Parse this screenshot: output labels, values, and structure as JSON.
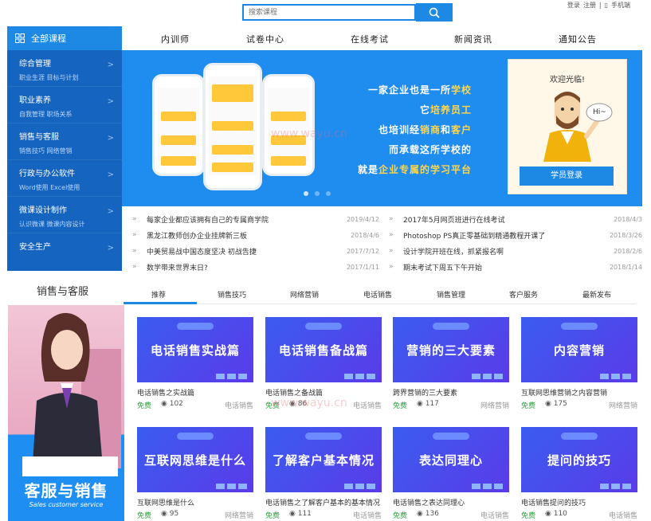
{
  "search": {
    "placeholder": "搜索课程"
  },
  "top_links": {
    "login": "登录",
    "register": "注册",
    "mobile": "手机端"
  },
  "sidebar": {
    "title": "全部课程",
    "items": [
      {
        "label": "综合管理",
        "sub": "职业生涯  目标与计划"
      },
      {
        "label": "职业素养",
        "sub": "自我管理  职场关系"
      },
      {
        "label": "销售与客服",
        "sub": "销售技巧  网络营销"
      },
      {
        "label": "行政与办公软件",
        "sub": "Word使用  Excel使用"
      },
      {
        "label": "微课设计制作",
        "sub": "认识微课  微课内容设计"
      },
      {
        "label": "安全生产",
        "sub": ""
      }
    ]
  },
  "nav": [
    "内训师",
    "试卷中心",
    "在线考试",
    "新闻资讯",
    "通知公告"
  ],
  "banner": {
    "slogans": [
      {
        "a": "一家企业也是一所",
        "b": "学校"
      },
      {
        "a": "它",
        "b": "培养员工",
        "c": ""
      },
      {
        "a": "也培训经",
        "b": "销商",
        "c": "和",
        "d": "客户"
      },
      {
        "a": "而承载这所学校的",
        "b": ""
      },
      {
        "a": "就是",
        "b": "企业专属的学习平台"
      }
    ],
    "welcome": "欢迎光临!",
    "greeting": "Hi~",
    "login_button": "学员登录"
  },
  "news_left": [
    {
      "title": "每家企业都应该拥有自己的专属商学院",
      "date": "2019/4/12"
    },
    {
      "title": "黑龙江教师创办企业挂牌新三板",
      "date": "2018/4/6"
    },
    {
      "title": "中美贸易战中国态度坚决 初战告捷",
      "date": "2017/7/12"
    },
    {
      "title": "数学带来世界末日?",
      "date": "2017/1/11"
    }
  ],
  "news_right": [
    {
      "title": "2017年5月网页班进行在线考试",
      "date": "2018/4/3"
    },
    {
      "title": "Photoshop PS真正零基础到精通教程开课了",
      "date": "2018/3/26"
    },
    {
      "title": "设计学院开班在线，抓紧报名啊",
      "date": "2018/2/6"
    },
    {
      "title": "期末考试下周五下午开始",
      "date": "2018/1/14"
    }
  ],
  "section": {
    "title": "销售与客服",
    "tabs": [
      "推荐",
      "销售技巧",
      "网络营销",
      "电话销售",
      "销售管理",
      "客户服务",
      "最新发布"
    ],
    "promo_title": "客服与销售",
    "promo_sub": "Sales customer service"
  },
  "courses": [
    {
      "cover": "电话销售实战篇",
      "name": "电话销售之实战篇",
      "free": "免费",
      "views": "102",
      "category": "电话销售"
    },
    {
      "cover": "电话销售备战篇",
      "name": "电话销售之备战篇",
      "free": "免费",
      "views": "86",
      "category": "电话销售"
    },
    {
      "cover": "营销的三大要素",
      "name": "跨界营销的三大要素",
      "free": "免费",
      "views": "117",
      "category": "网络营销"
    },
    {
      "cover": "内容营销",
      "name": "互联网思维营销之内容营销",
      "free": "免费",
      "views": "175",
      "category": "网络营销"
    },
    {
      "cover": "互联网思维是什么",
      "name": "互联网思维是什么",
      "free": "免费",
      "views": "95",
      "category": "网络营销"
    },
    {
      "cover": "了解客户基本情况",
      "name": "电话销售之了解客户基本的基本情况",
      "free": "免费",
      "views": "111",
      "category": "电话销售"
    },
    {
      "cover": "表达同理心",
      "name": "电话销售之表达同理心",
      "free": "免费",
      "views": "136",
      "category": "电话销售"
    },
    {
      "cover": "提问的技巧",
      "name": "电话销售提问的技巧",
      "free": "免费",
      "views": "110",
      "category": "电话销售"
    }
  ],
  "watermark": "www.wayu.cn",
  "colors": {
    "primary": "#1e88e5",
    "sidebar": "#1565c0",
    "banner": "#1f8cf0",
    "free": "#2e9e3e"
  }
}
